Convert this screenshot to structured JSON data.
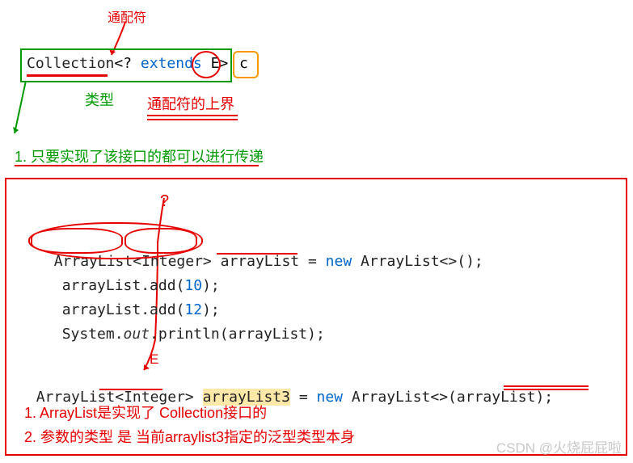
{
  "annotation_top": "通配符",
  "collection_code": {
    "cls": "Collection",
    "lt": "<",
    "q": "?",
    "kw": "extends",
    "e": "E",
    "gt": ">",
    "c": "c"
  },
  "label_type": "类型",
  "label_upper_bound": "通配符的上界",
  "point1": "1. 只要实现了该接口的都可以进行传递",
  "question_mark": "?",
  "code_lines": {
    "l1_a": "ArrayList<",
    "l1_int": "Integer",
    "l1_b": "> ",
    "l1_var": "arrayList",
    "l1_c": " = ",
    "l1_new": "new",
    "l1_d": " ArrayList<>();",
    "l2_a": "arrayList.add(",
    "l2_n": "10",
    "l2_b": ");",
    "l3_a": "arrayList.add(",
    "l3_n": "12",
    "l3_b": ");",
    "l4_a": "System.",
    "l4_out": "out",
    "l4_b": ".println(arrayList);",
    "l5_a": "ArrayList<",
    "l5_int": "Integer",
    "l5_b": "> ",
    "l5_var": "arrayList3",
    "l5_c": " = ",
    "l5_new": "new",
    "l5_d": " ArrayList<>(",
    "l5_arg": "arrayList",
    "l5_e": ");"
  },
  "e_label": "E",
  "note1": "1. ArrayList是实现了 Collection接口的",
  "note2": "2. 参数的类型 是 当前arraylist3指定的泛型类型本身",
  "watermark": "CSDN @火烧屁屁啦"
}
